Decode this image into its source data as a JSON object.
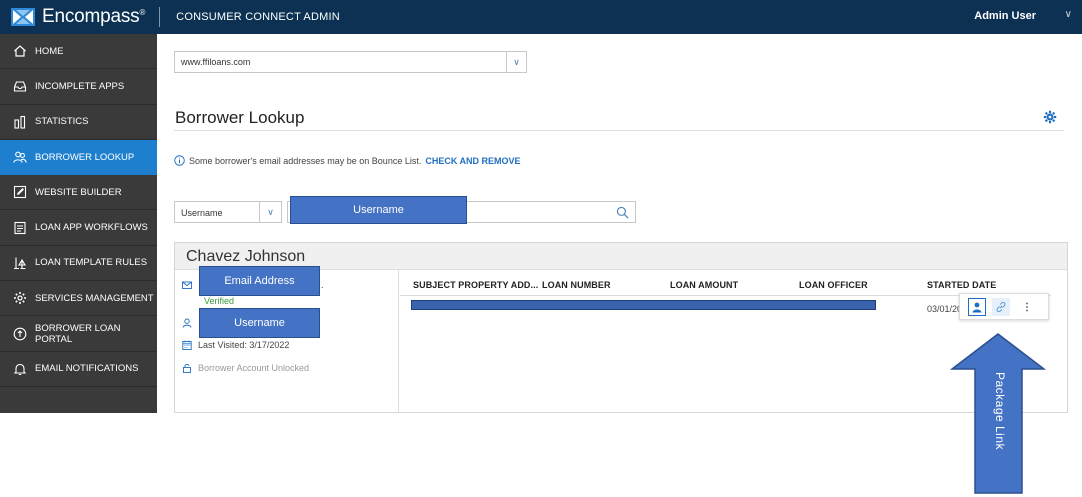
{
  "topbar": {
    "brand": "Encompass",
    "brand_mark": "®",
    "product": "CONSUMER CONNECT ADMIN",
    "user": "Admin User",
    "brand_color": "#0c3152"
  },
  "sidebar": {
    "items": [
      {
        "label": "HOME",
        "icon": "home-icon",
        "active": false
      },
      {
        "label": "INCOMPLETE APPS",
        "icon": "inbox-icon",
        "active": false
      },
      {
        "label": "STATISTICS",
        "icon": "bar-chart-icon",
        "active": false
      },
      {
        "label": "BORROWER LOOKUP",
        "icon": "users-icon",
        "active": true
      },
      {
        "label": "WEBSITE BUILDER",
        "icon": "edit-icon",
        "active": false
      },
      {
        "label": "LOAN APP WORKFLOWS",
        "icon": "document-icon",
        "active": false
      },
      {
        "label": "LOAN TEMPLATE RULES",
        "icon": "scale-icon",
        "active": false
      },
      {
        "label": "SERVICES MANAGEMENT",
        "icon": "gear-icon",
        "active": false
      },
      {
        "label": "BORROWER LOAN PORTAL",
        "icon": "portal-icon",
        "active": false
      },
      {
        "label": "EMAIL NOTIFICATIONS",
        "icon": "bell-icon",
        "active": false
      }
    ],
    "active_color": "#1f7fcf"
  },
  "site_select": {
    "value": "www.ffiloans.com"
  },
  "page": {
    "title": "Borrower Lookup"
  },
  "notice": {
    "text": "Some borrower's email addresses may be on Bounce List.",
    "link": "CHECK AND REMOVE"
  },
  "search": {
    "type_value": "Username",
    "input_value": ""
  },
  "callouts": {
    "username_search": "Username",
    "email": "Email Address",
    "username_card": "Username",
    "package_link": "Package Link",
    "color": "#4472c4"
  },
  "borrower": {
    "name": "Chavez Johnson",
    "email_trail": ".",
    "email_status": "Verified",
    "last_visited": "Last Visited: 3/17/2022",
    "account_status": "Borrower Account Unlocked"
  },
  "loans_table": {
    "columns": [
      "SUBJECT PROPERTY ADD...",
      "LOAN NUMBER",
      "LOAN AMOUNT",
      "LOAN OFFICER",
      "STARTED DATE"
    ],
    "rows": [
      {
        "started_date": "03/01/20"
      }
    ]
  }
}
